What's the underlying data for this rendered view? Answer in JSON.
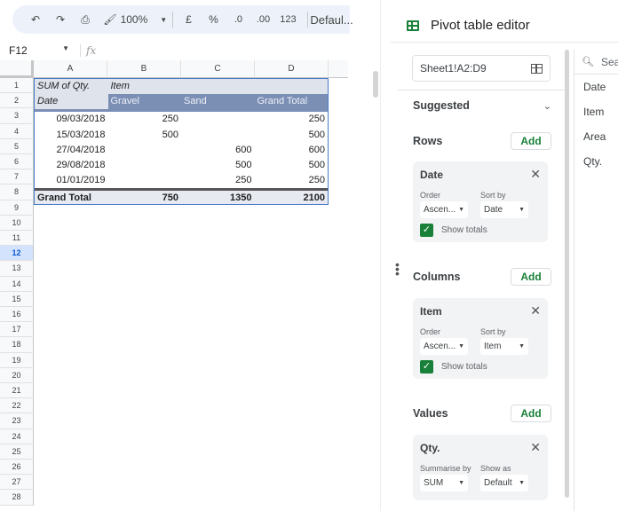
{
  "toolbar": {
    "zoom": "100%",
    "currency": "£",
    "percent": "%",
    "decrease_decimal": ".0",
    "increase_decimal": ".00",
    "number_format": "123",
    "font": "Defaul..."
  },
  "formula_bar": {
    "cell_ref": "F12",
    "fx": "fx",
    "value": ""
  },
  "grid": {
    "columns": [
      "A",
      "B",
      "C",
      "D"
    ],
    "rows": [
      "1",
      "2",
      "3",
      "4",
      "5",
      "6",
      "7",
      "8",
      "9",
      "10",
      "11",
      "12",
      "13",
      "14",
      "15",
      "16",
      "17",
      "18",
      "19",
      "20",
      "21",
      "22",
      "23",
      "24",
      "25",
      "26",
      "27",
      "28"
    ],
    "selected_row": "12"
  },
  "pivot": {
    "header1": {
      "a": "SUM of Qty.",
      "b": "Item"
    },
    "header2": {
      "a": "Date",
      "b": "Gravel",
      "c": "Sand",
      "d": "Grand Total"
    },
    "data": [
      {
        "date": "09/03/2018",
        "gravel": "250",
        "sand": "",
        "total": "250"
      },
      {
        "date": "15/03/2018",
        "gravel": "500",
        "sand": "",
        "total": "500"
      },
      {
        "date": "27/04/2018",
        "gravel": "",
        "sand": "600",
        "total": "600"
      },
      {
        "date": "29/08/2018",
        "gravel": "",
        "sand": "500",
        "total": "500"
      },
      {
        "date": "01/01/2019",
        "gravel": "",
        "sand": "250",
        "total": "250"
      }
    ],
    "grand_total": {
      "label": "Grand Total",
      "gravel": "750",
      "sand": "1350",
      "total": "2100"
    }
  },
  "editor": {
    "title": "Pivot table editor",
    "range": "Sheet1!A2:D9",
    "suggested": "Suggested",
    "add_label": "Add",
    "rows": {
      "title": "Rows",
      "card": {
        "field": "Date",
        "label1": "Order",
        "value1": "Ascen...",
        "label2": "Sort by",
        "value2": "Date",
        "show_totals": "Show totals",
        "checked": true
      }
    },
    "columns": {
      "title": "Columns",
      "card": {
        "field": "Item",
        "label1": "Order",
        "value1": "Ascen...",
        "label2": "Sort by",
        "value2": "Item",
        "show_totals": "Show totals",
        "checked": true
      }
    },
    "values": {
      "title": "Values",
      "card": {
        "field": "Qty.",
        "label1": "Summarise by",
        "value1": "SUM",
        "label2": "Show as",
        "value2": "Default"
      }
    },
    "search_placeholder": "Sea",
    "fields": [
      "Date",
      "Item",
      "Area",
      "Qty."
    ]
  }
}
